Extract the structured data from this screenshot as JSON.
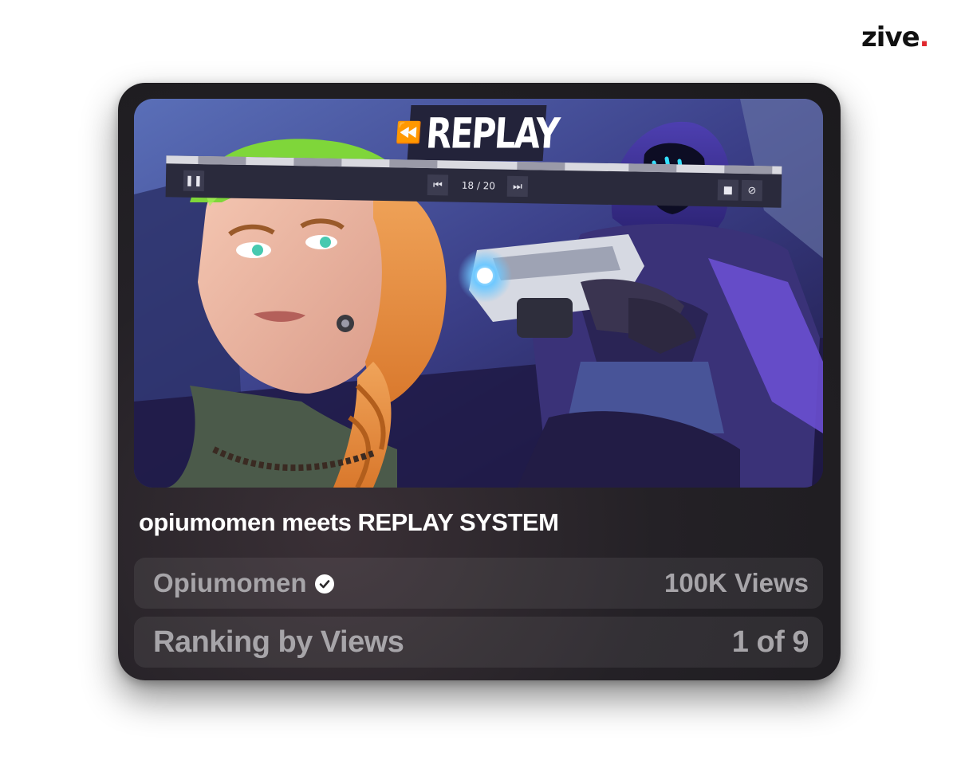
{
  "brand": {
    "name": "zive",
    "dot": "."
  },
  "thumbnail": {
    "banner_text": "REPLAY",
    "rewind_icon": "rewind-icon",
    "counter": "18 / 20",
    "controls": {
      "pause_icon": "pause-icon",
      "prev_icon": "skip-back-icon",
      "next_icon": "skip-forward-icon",
      "camera_icon": "camera-icon",
      "hide_icon": "eye-off-icon"
    }
  },
  "video": {
    "title": "opiumomen meets REPLAY SYSTEM",
    "channel": "Opiumomen",
    "verified_icon": "verified-check-icon",
    "views": "100K Views"
  },
  "ranking": {
    "label": "Ranking by Views",
    "value": "1 of 9"
  },
  "colors": {
    "accent": "#e0282e",
    "card_bg": "#242126",
    "muted_text": "#a7a5a9"
  }
}
